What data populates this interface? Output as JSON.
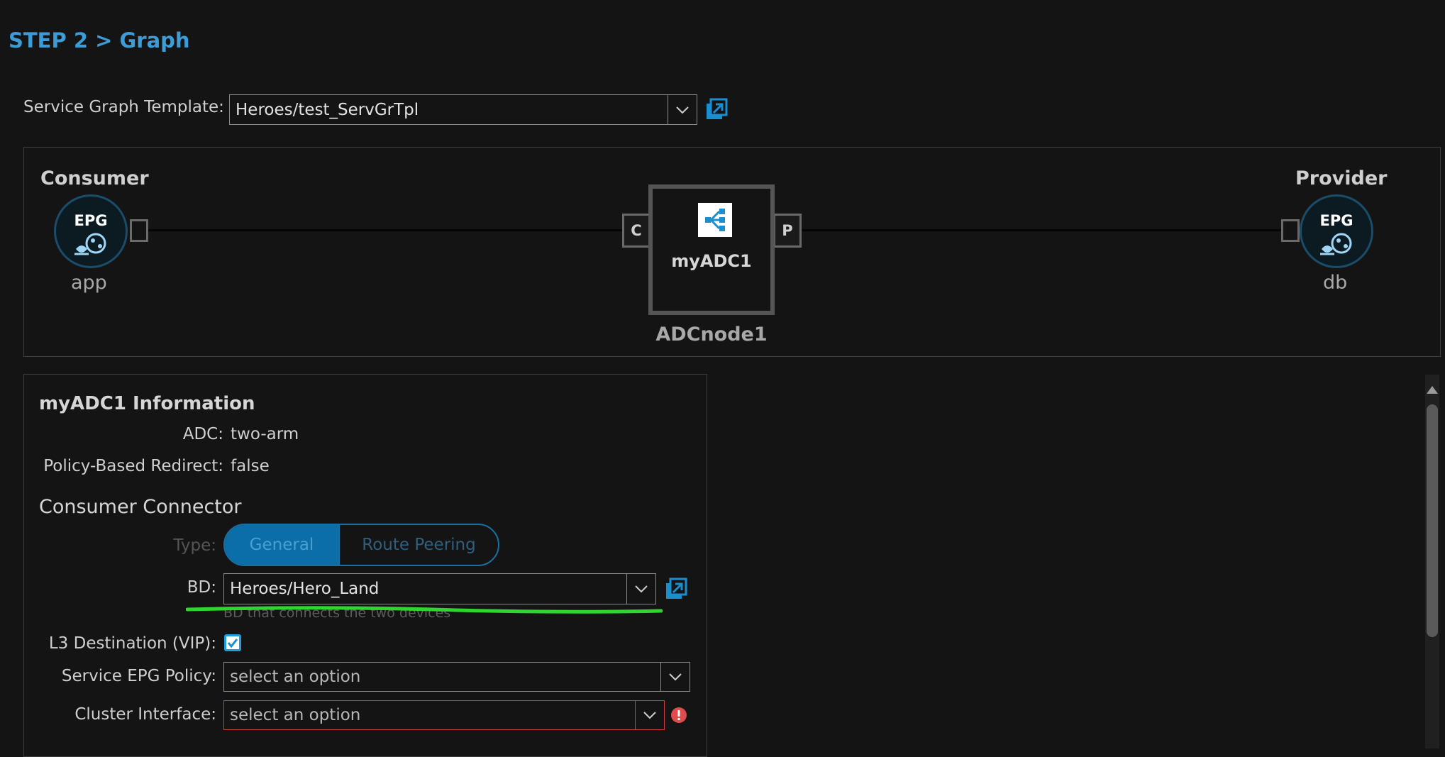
{
  "header": {
    "title": "STEP 2 > Graph"
  },
  "template": {
    "label": "Service Graph Template:",
    "value": "Heroes/test_ServGrTpl"
  },
  "graph": {
    "consumer": {
      "title": "Consumer",
      "badge": "EPG",
      "name": "app"
    },
    "provider": {
      "title": "Provider",
      "badge": "EPG",
      "name": "db"
    },
    "node": {
      "name": "myADC1",
      "label": "ADCnode1",
      "port_consumer": "C",
      "port_provider": "P"
    }
  },
  "info": {
    "title": "myADC1 Information",
    "adc_label": "ADC:",
    "adc_value": "two-arm",
    "pbr_label": "Policy-Based Redirect:",
    "pbr_value": "false",
    "consumer_connector": {
      "heading": "Consumer Connector",
      "type_label": "Type:",
      "type_options": [
        "General",
        "Route Peering"
      ],
      "type_selected": "General",
      "bd_label": "BD:",
      "bd_value": "Heroes/Hero_Land",
      "bd_helper": "BD that connects the two devices",
      "l3_label": "L3 Destination (VIP):",
      "l3_checked": true,
      "service_epg_label": "Service EPG Policy:",
      "service_epg_placeholder": "select an option",
      "cluster_label": "Cluster Interface:",
      "cluster_placeholder": "select an option"
    }
  },
  "colors": {
    "accent": "#3d9bd6",
    "error": "#e04b4b",
    "highlight": "#2fd62f",
    "toggle_active": "#0b6ea8"
  },
  "icons": [
    "chevron-down-icon",
    "external-link-icon",
    "epg-icon",
    "load-balancer-icon",
    "checkmark-icon",
    "error-icon",
    "scroll-up-icon"
  ]
}
